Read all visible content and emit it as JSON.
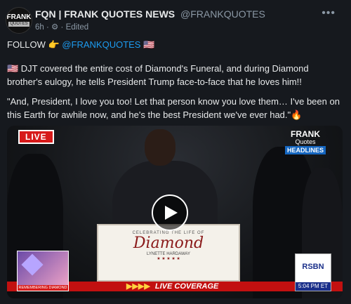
{
  "header": {
    "name": "FQN | FRANK QUOTES NEWS",
    "handle": "@FRANKQUOTES",
    "time": "6h",
    "edited": "Edited",
    "avatar_line1": "FRANK",
    "avatar_line2": "QUOTES"
  },
  "post": {
    "follow_prefix": "FOLLOW 👉",
    "follow_mention": "@FRANKQUOTES",
    "follow_suffix": "🇺🇸",
    "para1": "🇺🇸 DJT covered the entire cost of Diamond's Funeral, and during Diamond brother's eulogy, he tells President Trump face-to-face that he loves him!!",
    "para2": "\"And, President, I love you too! Let that person know you love them… I've been on this Earth for awhile now, and he's the best President we've ever had.\"🔥"
  },
  "video": {
    "live": "LIVE",
    "brand_line1": "FRANK",
    "brand_line2": "Quotes",
    "brand_line3": "HEADLINES",
    "lectern_small": "CELEBRATING THE LIFE OF",
    "lectern_name": "Diamond",
    "lectern_sub": "LYNETTE HARDAWAY",
    "coverage": "LIVE COVERAGE",
    "thumb_label": "REMEMBERING DIAMOND",
    "rsbn": "RSBN",
    "rsbn_time": "5:04 PM ET"
  },
  "icons": [
    "globe-icon",
    "more-icon",
    "play-icon"
  ]
}
